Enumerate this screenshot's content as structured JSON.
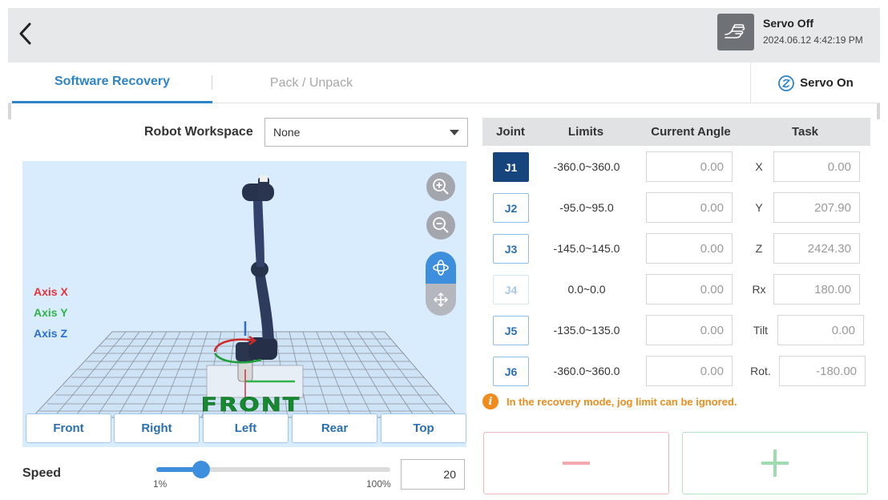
{
  "header": {
    "back_icon": "chevron-left-icon",
    "servo_icon": "hand-icon",
    "servo_status": "Servo Off",
    "datetime": "2024.06.12 4:42:19 PM"
  },
  "tabs": [
    {
      "label": "Software Recovery",
      "active": true
    },
    {
      "label": "Pack / Unpack",
      "active": false
    }
  ],
  "servo_on": {
    "label": "Servo On",
    "icon": "servo-power-icon",
    "color": "#2d83c8"
  },
  "workspace": {
    "label": "Robot Workspace",
    "value": "None"
  },
  "viewport": {
    "axes": [
      {
        "label": "Axis X",
        "color": "#e8323a"
      },
      {
        "label": "Axis Y",
        "color": "#2fb34a"
      },
      {
        "label": "Axis Z",
        "color": "#2d6fd0"
      }
    ],
    "floor_text": "FRONT",
    "background": "#d8ecfd"
  },
  "view_buttons": [
    "Front",
    "Right",
    "Left",
    "Rear",
    "Top"
  ],
  "speed": {
    "label": "Speed",
    "value": "20",
    "min_label": "1%",
    "max_label": "100%",
    "percent": 20
  },
  "joint_table": {
    "headers": {
      "joint": "Joint",
      "limits": "Limits",
      "angle": "Current Angle",
      "task": "Task"
    },
    "rows": [
      {
        "joint": "J1",
        "limits": "-360.0~360.0",
        "angle": "0.00",
        "task_label": "X",
        "task_value": "0.00",
        "state": "active"
      },
      {
        "joint": "J2",
        "limits": "-95.0~95.0",
        "angle": "0.00",
        "task_label": "Y",
        "task_value": "207.90",
        "state": "normal"
      },
      {
        "joint": "J3",
        "limits": "-145.0~145.0",
        "angle": "0.00",
        "task_label": "Z",
        "task_value": "2424.30",
        "state": "normal"
      },
      {
        "joint": "J4",
        "limits": "0.0~0.0",
        "angle": "0.00",
        "task_label": "Rx",
        "task_value": "180.00",
        "state": "disabled"
      },
      {
        "joint": "J5",
        "limits": "-135.0~135.0",
        "angle": "0.00",
        "task_label": "Tilt",
        "task_value": "0.00",
        "state": "normal"
      },
      {
        "joint": "J6",
        "limits": "-360.0~360.0",
        "angle": "0.00",
        "task_label": "Rot.",
        "task_value": "-180.00",
        "state": "normal"
      }
    ]
  },
  "notice": {
    "icon": "info-icon",
    "text": "In the recovery mode, jog limit can be ignored."
  },
  "jog": {
    "minus_color": "#f3a9b0",
    "plus_color": "#9fdcb0"
  }
}
